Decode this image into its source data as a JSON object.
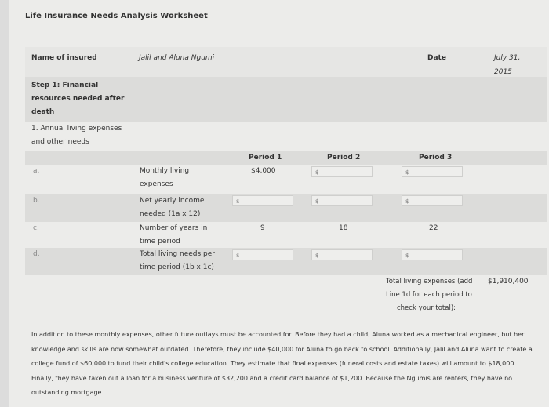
{
  "title": "Life Insurance Needs Analysis Worksheet",
  "name_label": "Name of insured",
  "name_value": "Jalil and Aluna Ngumi",
  "date_label": "Date",
  "date_value_line1": "July 31,",
  "date_value_line2": "2015",
  "step1": [
    "Step 1: Financial",
    "resources needed after",
    "death"
  ],
  "item1": [
    "1. Annual living expenses",
    "and other needs"
  ],
  "periods": [
    "Period 1",
    "Period 2",
    "Period 3"
  ],
  "currency": "$",
  "rows": [
    {
      "letter": "a.",
      "label": [
        "Monthly living",
        "expenses"
      ],
      "p1": "$4,000"
    },
    {
      "letter": "b.",
      "label": [
        "Net yearly income",
        "needed (1a x 12)"
      ]
    },
    {
      "letter": "c.",
      "label": [
        "Number of years in",
        "time period"
      ],
      "p1": "9",
      "p2": "18",
      "p3": "22"
    },
    {
      "letter": "d.",
      "label": [
        "Total living needs per",
        "time period (1b x 1c)"
      ]
    }
  ],
  "total_label": [
    "Total living expenses (add",
    "Line 1d for each period to",
    "check your total):"
  ],
  "total_value": "$1,910,400",
  "paragraph": "In addition to these monthly expenses, other future outlays must be accounted for. Before they had a child, Aluna worked as a mechanical engineer, but her knowledge and skills are now somewhat outdated. Therefore, they include $40,000 for Aluna to go back to school. Additionally, Jalil and Aluna want to create a college fund of $60,000 to fund their child's college education. They estimate that final expenses (funeral costs and estate taxes) will amount to $18,000. Finally, they have taken out a loan for a business venture of $32,200 and a credit card balance of $1,200. Because the Ngumis are renters, they have no outstanding mortgage."
}
